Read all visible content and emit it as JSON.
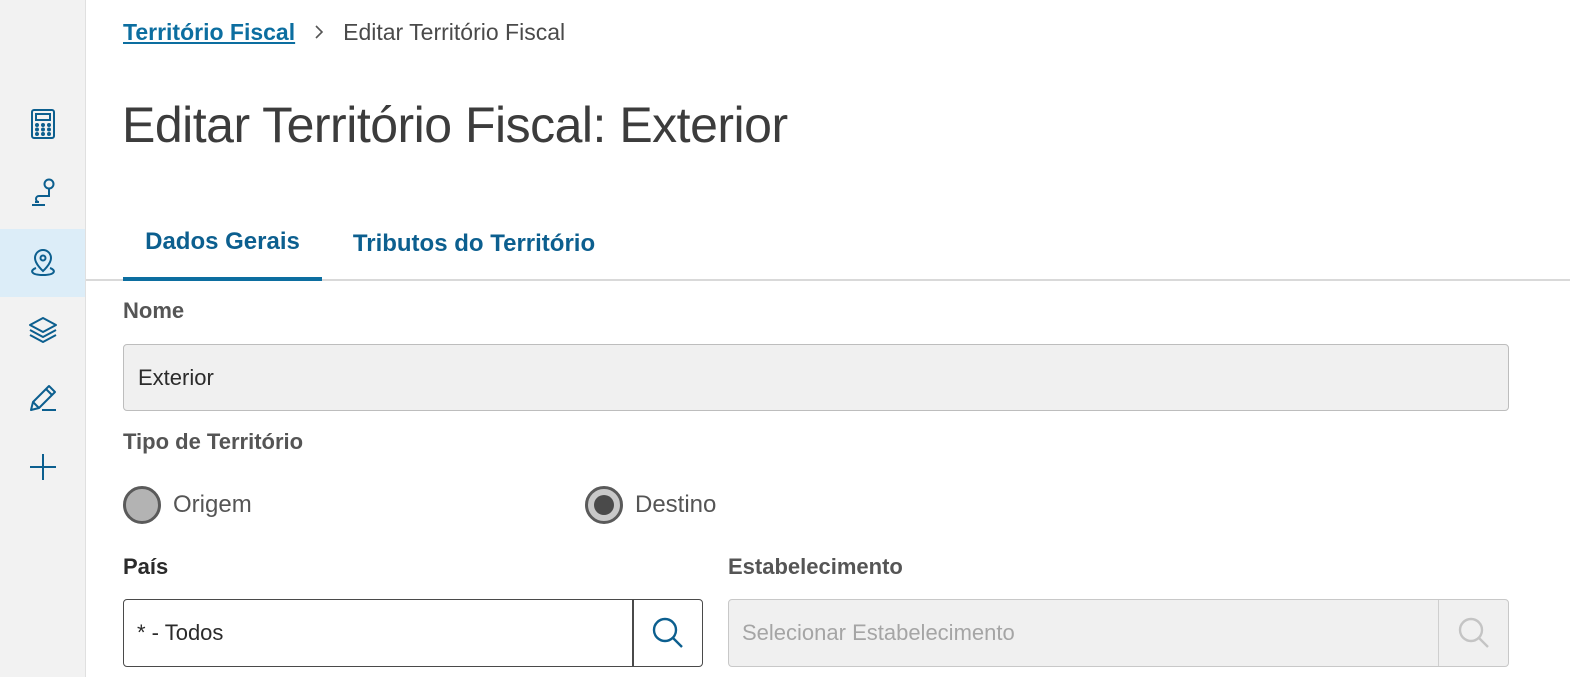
{
  "colors": {
    "accent": "#0c6ea0",
    "sidebar_bg": "#f2f2f2",
    "sidebar_active_bg": "#dcedf8",
    "disabled_bg": "#f0f0f0"
  },
  "sidebar": {
    "items": [
      {
        "icon": "calculator-icon",
        "active": false
      },
      {
        "icon": "route-pin-icon",
        "active": false
      },
      {
        "icon": "map-pin-icon",
        "active": true
      },
      {
        "icon": "layers-icon",
        "active": false
      },
      {
        "icon": "pencil-icon",
        "active": false
      },
      {
        "icon": "plus-icon",
        "active": false
      }
    ]
  },
  "breadcrumb": {
    "parent": "Território Fiscal",
    "current": "Editar Território Fiscal"
  },
  "page": {
    "title": "Editar Território Fiscal: Exterior"
  },
  "tabs": [
    {
      "label": "Dados Gerais",
      "active": true
    },
    {
      "label": "Tributos do Território",
      "active": false
    }
  ],
  "form": {
    "nome": {
      "label": "Nome",
      "value": "Exterior"
    },
    "tipo": {
      "label": "Tipo de Território",
      "options": [
        {
          "label": "Origem",
          "checked": false
        },
        {
          "label": "Destino",
          "checked": true
        }
      ]
    },
    "pais": {
      "label": "País",
      "value": "* - Todos",
      "icon": "search-icon"
    },
    "estabelecimento": {
      "label": "Estabelecimento",
      "placeholder": "Selecionar Estabelecimento",
      "icon": "search-icon"
    }
  }
}
